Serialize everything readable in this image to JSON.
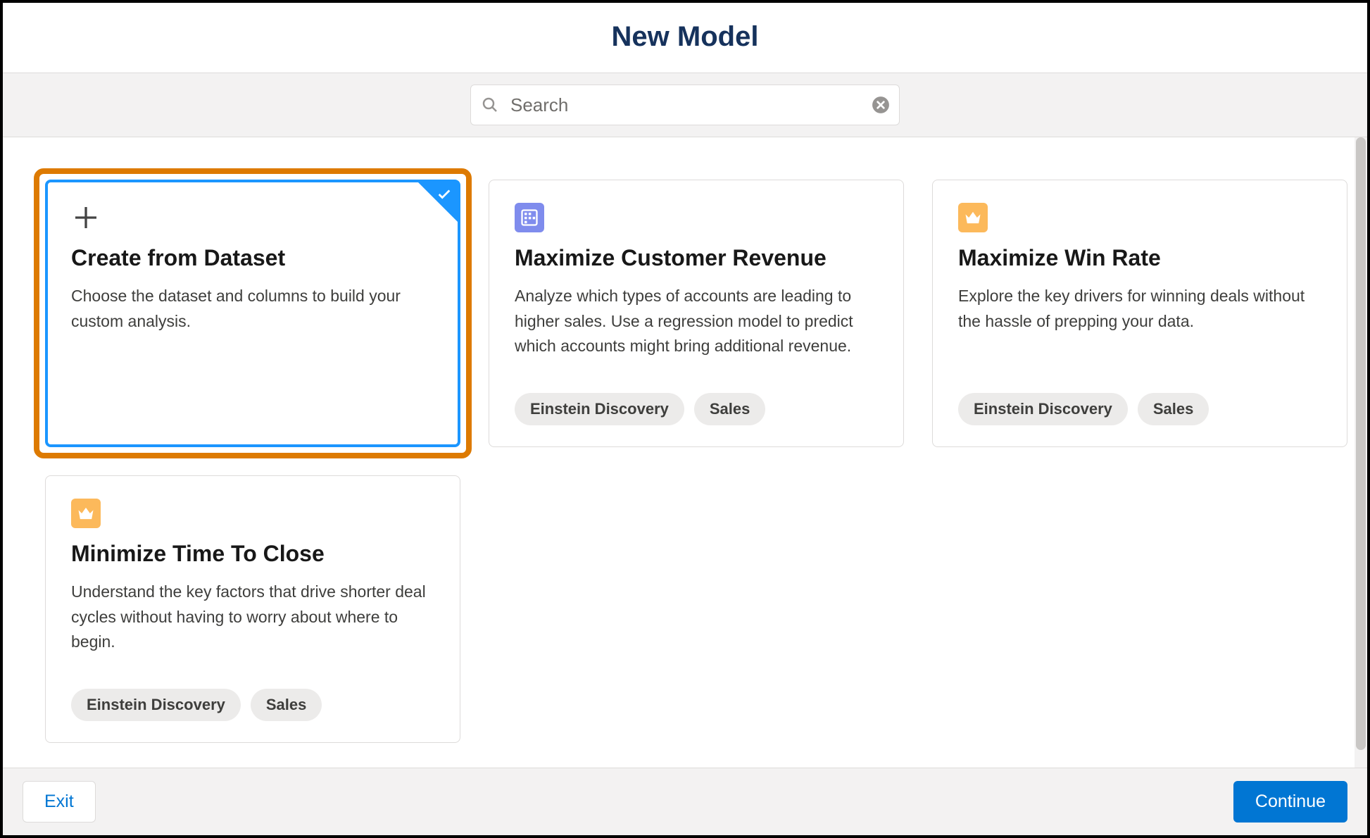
{
  "header": {
    "title": "New Model"
  },
  "search": {
    "placeholder": "Search",
    "value": ""
  },
  "cards": [
    {
      "id": "create-from-dataset",
      "icon": "plus",
      "title": "Create from Dataset",
      "description": "Choose the dataset and columns to build your custom analysis.",
      "tags": [],
      "selected": true,
      "highlighted": true
    },
    {
      "id": "maximize-customer-revenue",
      "icon": "grid",
      "title": "Maximize Customer Revenue",
      "description": "Analyze which types of accounts are leading to higher sales. Use a regression model to predict which accounts might bring additional revenue.",
      "tags": [
        "Einstein Discovery",
        "Sales"
      ],
      "selected": false,
      "highlighted": false
    },
    {
      "id": "maximize-win-rate",
      "icon": "crown",
      "title": "Maximize Win Rate",
      "description": "Explore the key drivers for winning deals without the hassle of prepping your data.",
      "tags": [
        "Einstein Discovery",
        "Sales"
      ],
      "selected": false,
      "highlighted": false
    },
    {
      "id": "minimize-time-to-close",
      "icon": "crown",
      "title": "Minimize Time To Close",
      "description": "Understand the key factors that drive shorter deal cycles without having to worry about where to begin.",
      "tags": [
        "Einstein Discovery",
        "Sales"
      ],
      "selected": false,
      "highlighted": false
    }
  ],
  "footer": {
    "exit": "Exit",
    "continue": "Continue"
  }
}
